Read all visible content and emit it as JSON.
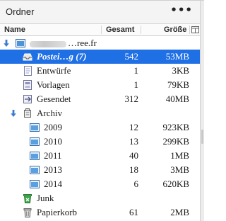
{
  "pane": {
    "title": "Ordner",
    "more_label": "•••"
  },
  "columns": {
    "name": "Name",
    "total": "Gesamt",
    "size": "Größe"
  },
  "account": {
    "name": "…ree.fr"
  },
  "folders": [
    {
      "id": "posteingang",
      "name": "Postei…g (7)",
      "total": "542",
      "size": "53MB",
      "icon": "inbox-icon",
      "selected": true
    },
    {
      "id": "entwuerfe",
      "name": "Entwürfe",
      "total": "1",
      "size": "3KB",
      "icon": "drafts-icon"
    },
    {
      "id": "vorlagen",
      "name": "Vorlagen",
      "total": "1",
      "size": "79KB",
      "icon": "templates-icon"
    },
    {
      "id": "gesendet",
      "name": "Gesendet",
      "total": "312",
      "size": "40MB",
      "icon": "sent-icon"
    },
    {
      "id": "archiv",
      "name": "Archiv",
      "total": "",
      "size": "",
      "icon": "archive-icon"
    },
    {
      "id": "2009",
      "name": "2009",
      "total": "12",
      "size": "923KB",
      "icon": "folder-icon"
    },
    {
      "id": "2010",
      "name": "2010",
      "total": "13",
      "size": "299KB",
      "icon": "folder-icon"
    },
    {
      "id": "2011",
      "name": "2011",
      "total": "40",
      "size": "1MB",
      "icon": "folder-icon"
    },
    {
      "id": "2013",
      "name": "2013",
      "total": "18",
      "size": "3MB",
      "icon": "folder-icon"
    },
    {
      "id": "2014",
      "name": "2014",
      "total": "6",
      "size": "620KB",
      "icon": "folder-icon"
    },
    {
      "id": "junk",
      "name": "Junk",
      "total": "",
      "size": "",
      "icon": "junk-icon"
    },
    {
      "id": "papierkorb",
      "name": "Papierkorb",
      "total": "61",
      "size": "2MB",
      "icon": "trash-icon"
    }
  ],
  "colors": {
    "selection": "#1f6fe5",
    "twisty": "#3d7bd0",
    "folder_blue": "#5aa0e0",
    "junk_green": "#3fa84a"
  }
}
